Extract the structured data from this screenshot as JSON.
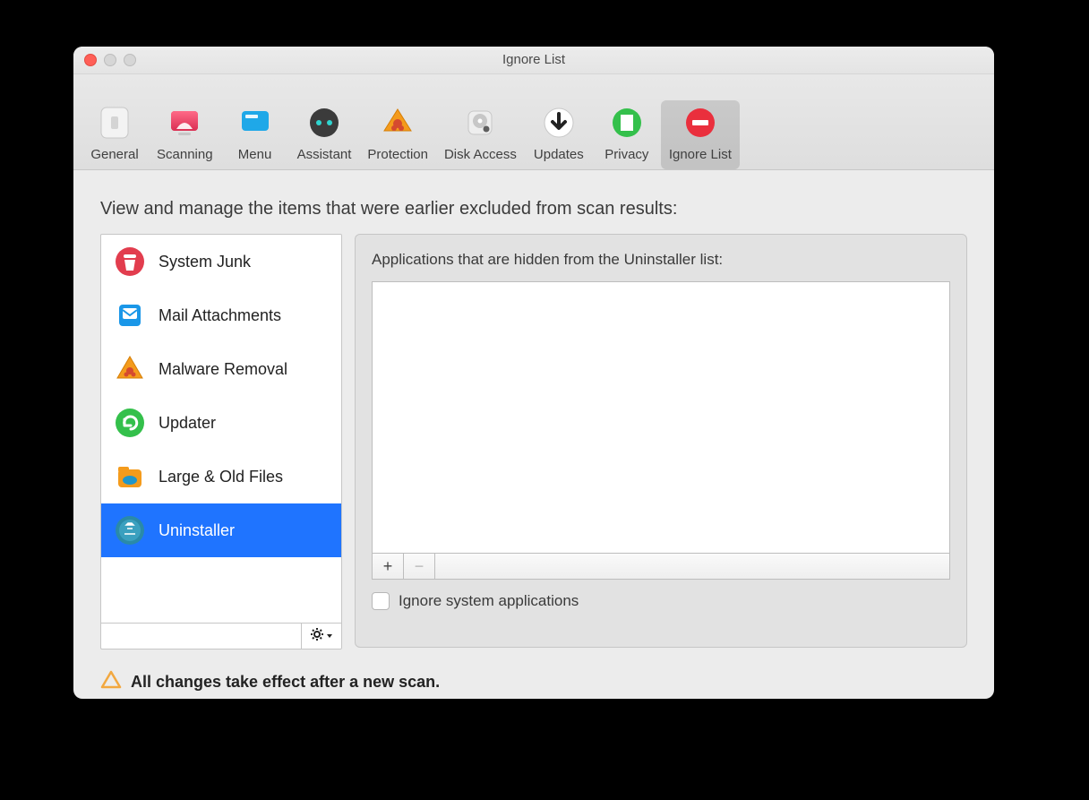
{
  "window": {
    "title": "Ignore List"
  },
  "toolbar": {
    "items": [
      {
        "id": "general",
        "label": "General"
      },
      {
        "id": "scanning",
        "label": "Scanning"
      },
      {
        "id": "menu",
        "label": "Menu"
      },
      {
        "id": "assistant",
        "label": "Assistant"
      },
      {
        "id": "protection",
        "label": "Protection"
      },
      {
        "id": "diskaccess",
        "label": "Disk Access"
      },
      {
        "id": "updates",
        "label": "Updates"
      },
      {
        "id": "privacy",
        "label": "Privacy"
      },
      {
        "id": "ignorelist",
        "label": "Ignore List"
      }
    ],
    "selected": "ignorelist"
  },
  "description": "View and manage the items that were earlier excluded from scan results:",
  "sidebar": {
    "items": [
      {
        "id": "systemjunk",
        "label": "System Junk"
      },
      {
        "id": "mail",
        "label": "Mail Attachments"
      },
      {
        "id": "malware",
        "label": "Malware Removal"
      },
      {
        "id": "updater",
        "label": "Updater"
      },
      {
        "id": "large",
        "label": "Large & Old Files"
      },
      {
        "id": "uninstaller",
        "label": "Uninstaller"
      }
    ],
    "selected": "uninstaller"
  },
  "main": {
    "title": "Applications that are hidden from the Uninstaller list:",
    "checkbox_label": "Ignore system applications",
    "checkbox_checked": false,
    "add_label": "+",
    "remove_label": "−"
  },
  "notice": "All changes take effect after a new scan."
}
